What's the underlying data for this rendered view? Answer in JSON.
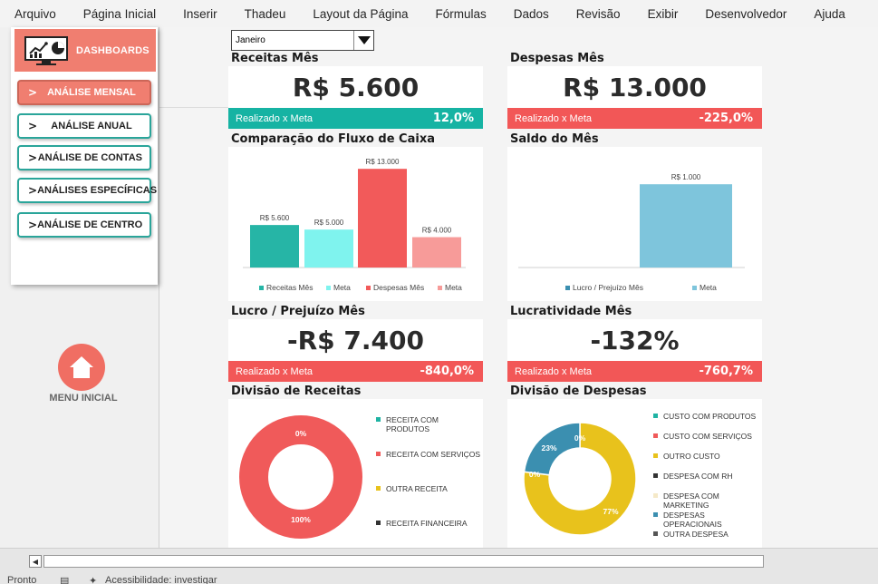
{
  "ribbon": {
    "tabs": [
      "Arquivo",
      "Página Inicial",
      "Inserir",
      "Thadeu",
      "Layout da Página",
      "Fórmulas",
      "Dados",
      "Revisão",
      "Exibir",
      "Desenvolvedor",
      "Ajuda"
    ]
  },
  "nav": {
    "header_label": "DASHBOARDS",
    "items": [
      {
        "label": "ANÁLISE MENSAL",
        "active": true
      },
      {
        "label": "ANÁLISE ANUAL",
        "active": false
      },
      {
        "label": "ANÁLISE DE CONTAS",
        "active": false
      },
      {
        "label": "ANÁLISES ESPECÍFICAS",
        "active": false
      },
      {
        "label": "ANÁLISE DE CENTRO",
        "active": false
      }
    ],
    "chevron": ">",
    "home_label": "MENU INICIAL",
    "icons": {
      "header": "dashboard-monitor-icon",
      "home": "home-icon"
    }
  },
  "filter": {
    "month": "Janeiro"
  },
  "colors": {
    "teal": "#26b5a6",
    "aqua": "#7ff3ee",
    "coral": "#f25a5a",
    "pink": "#f79b99",
    "sky": "#7ec5dc",
    "red_bar": "#f05a5a",
    "teal_bar": "#1fb3a3",
    "yellow": "#e8c21c",
    "steel": "#3b8fb0"
  },
  "kpis": {
    "receitas": {
      "title": "Receitas Mês",
      "value": "R$ 5.600",
      "bar_label": "Realizado x Meta",
      "pct": "12,0%"
    },
    "despesas": {
      "title": "Despesas Mês",
      "value": "R$ 13.000",
      "bar_label": "Realizado x Meta",
      "pct": "-225,0%"
    },
    "lucro": {
      "title": "Lucro / Prejuízo Mês",
      "value": "-R$ 7.400",
      "bar_label": "Realizado x Meta",
      "pct": "-840,0%"
    },
    "lucratividade": {
      "title": "Lucratividade Mês",
      "value": "-132%",
      "bar_label": "Realizado x Meta",
      "pct": "-760,7%"
    }
  },
  "sections": {
    "fluxo": "Comparação do Fluxo de Caixa",
    "saldo": "Saldo do Mês",
    "div_receitas": "Divisão de Receitas",
    "div_despesas": "Divisão de Despesas"
  },
  "chart_data": [
    {
      "type": "bar",
      "categories": [
        "Receitas Mês",
        "Meta",
        "Despesas Mês",
        "Meta"
      ],
      "values": [
        5600,
        5000,
        13000,
        4000
      ],
      "labels": [
        "R$ 5.600",
        "R$ 5.000",
        "R$ 13.000",
        "R$ 4.000"
      ],
      "colors": [
        "#26b5a6",
        "#7ff3ee",
        "#f25a5a",
        "#f79b99"
      ],
      "ylim": [
        0,
        13500
      ],
      "legend": "bottom"
    },
    {
      "type": "bar",
      "categories": [
        "Lucro / Prejuízo Mês",
        "Meta"
      ],
      "values": [
        0,
        1000
      ],
      "labels": [
        "",
        "R$ 1.000"
      ],
      "colors": [
        "#3b8fb0",
        "#7ec5dc"
      ],
      "ylim": [
        0,
        1100
      ],
      "legend": "bottom"
    },
    {
      "type": "pie",
      "donut": true,
      "categories": [
        "RECEITA COM PRODUTOS",
        "RECEITA COM SERVIÇOS",
        "OUTRA RECEITA",
        "RECEITA FINANCEIRA"
      ],
      "values": [
        0,
        100,
        0,
        0
      ],
      "data_labels": [
        "0%",
        "100%",
        "",
        ""
      ],
      "colors": [
        "#1fb3a3",
        "#f05a5a",
        "#e8c21c",
        "#333333"
      ],
      "legend": "right"
    },
    {
      "type": "pie",
      "donut": true,
      "categories": [
        "CUSTO COM PRODUTOS",
        "CUSTO COM SERVIÇOS",
        "OUTRO CUSTO",
        "DESPESA COM RH",
        "DESPESA COM MARKETING",
        "DESPESAS OPERACIONAIS",
        "OUTRA DESPESA"
      ],
      "values": [
        0,
        0,
        77,
        0,
        0,
        23,
        0
      ],
      "data_labels": [
        "0%",
        "",
        "77%",
        "0%",
        "",
        "23%",
        ""
      ],
      "colors": [
        "#1fb3a3",
        "#f05a5a",
        "#e8c21c",
        "#333333",
        "#f5e9c8",
        "#3b8fb0",
        "#555555"
      ],
      "legend": "right"
    }
  ],
  "statusbar": {
    "ready": "Pronto",
    "accessibility": "Acessibilidade: investigar"
  }
}
